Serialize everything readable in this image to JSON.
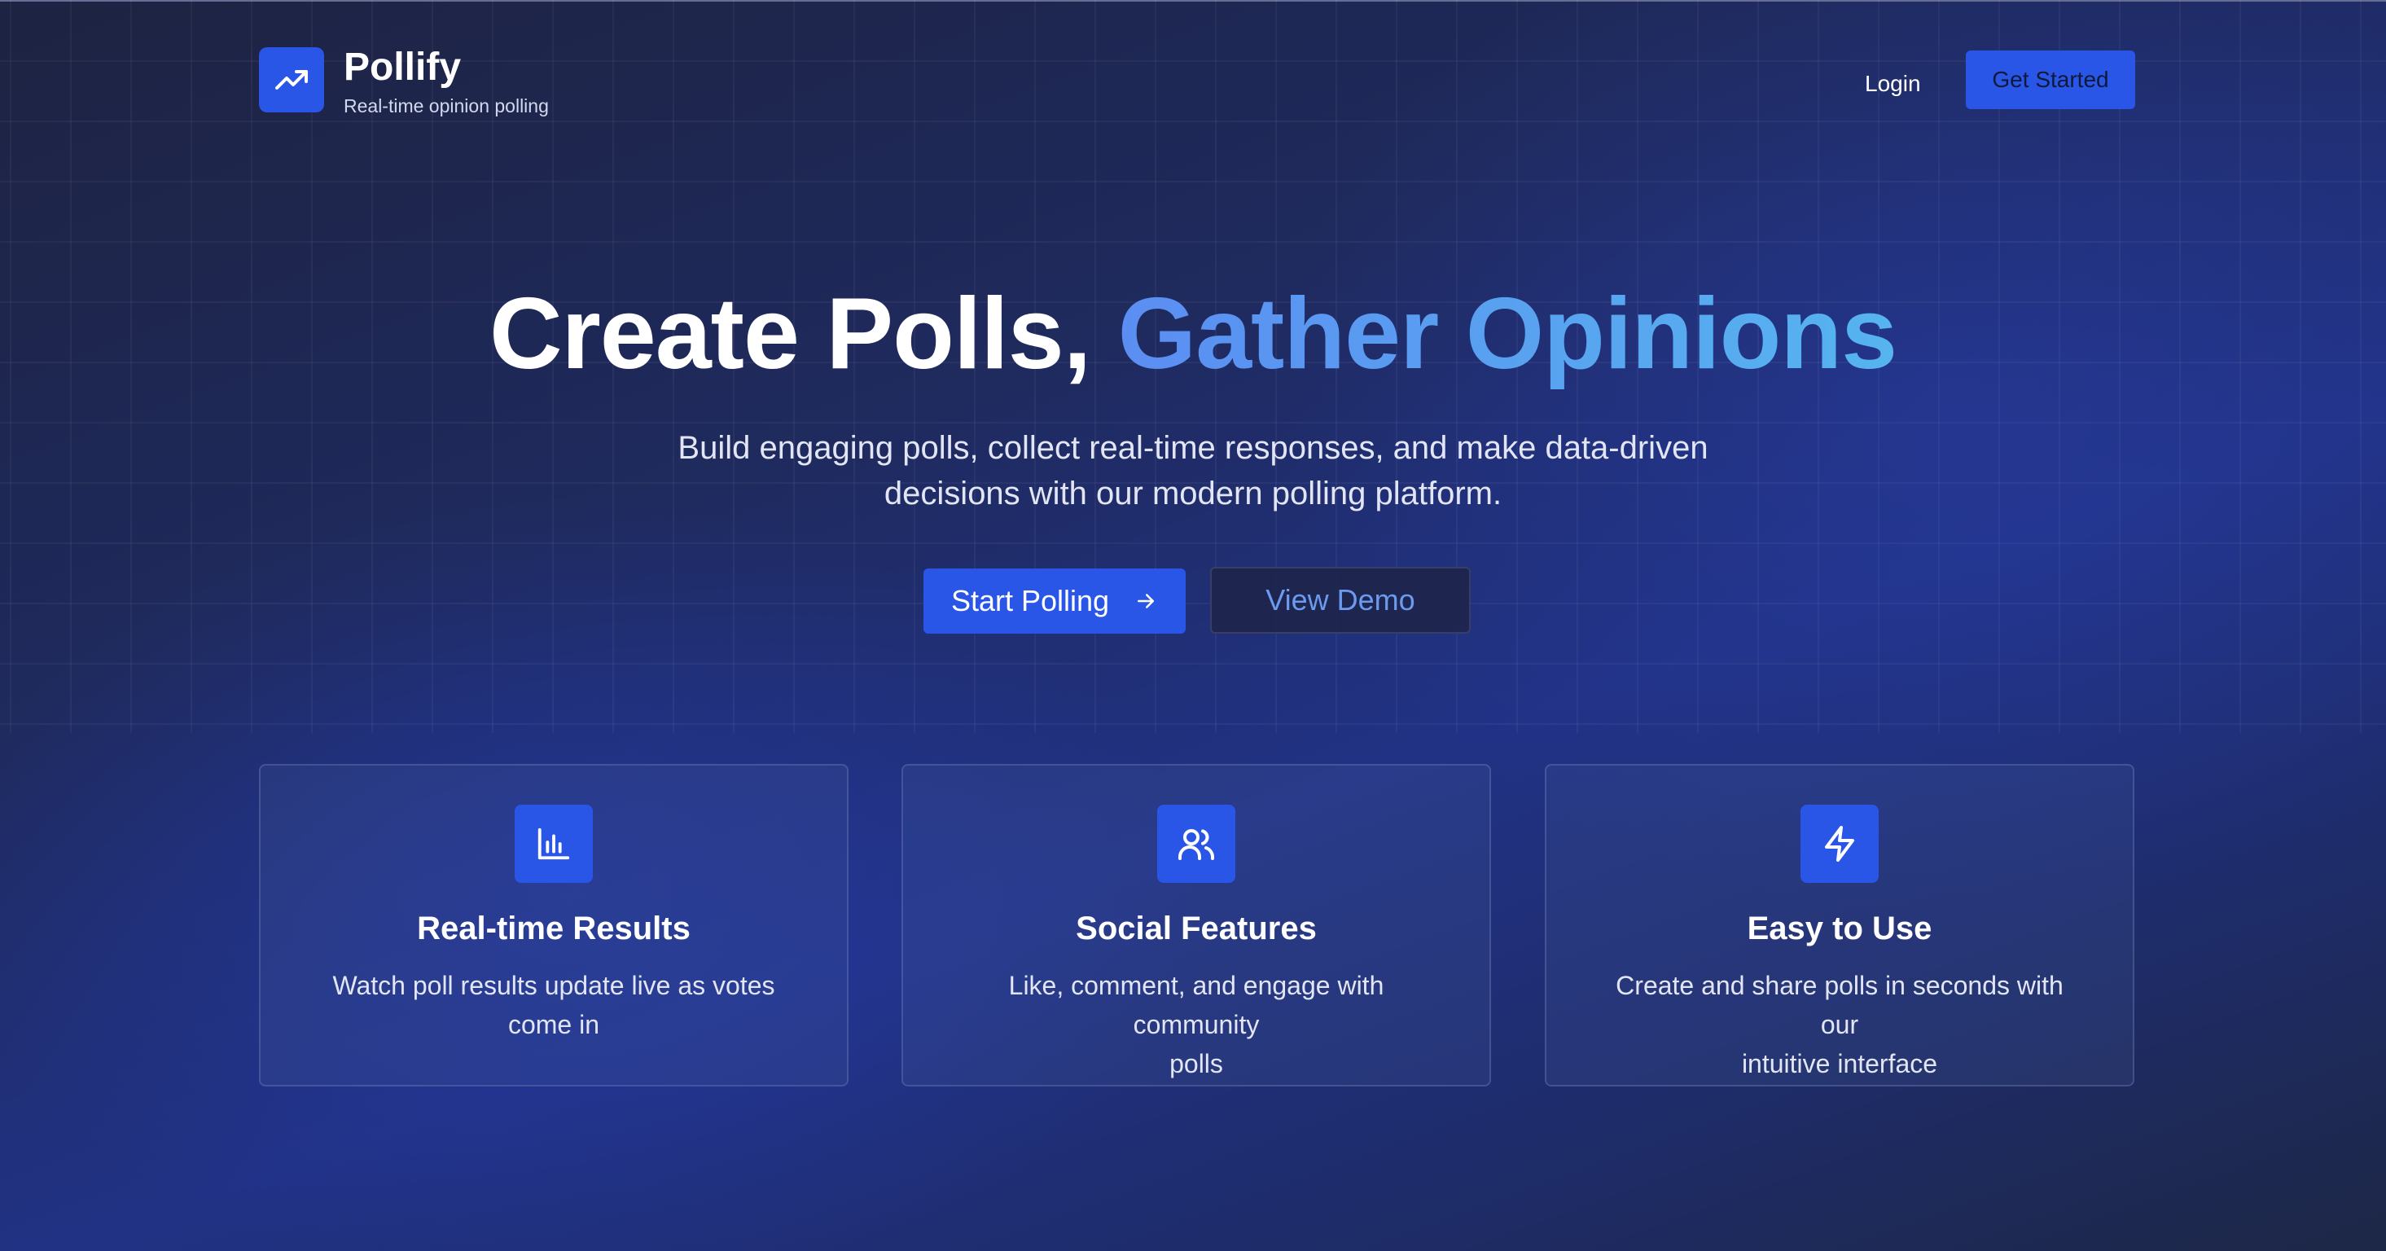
{
  "brand": {
    "name": "Pollify",
    "tagline": "Real-time opinion polling"
  },
  "nav": {
    "login_label": "Login",
    "get_started_label": "Get Started"
  },
  "hero": {
    "title_plain": "Create Polls,",
    "title_highlight": "Gather Opinions",
    "subtitle_line1": "Build engaging polls, collect real-time responses, and make data-driven",
    "subtitle_line2": "decisions with our modern polling platform.",
    "start_button_label": "Start Polling",
    "demo_button_label": "View Demo"
  },
  "features": [
    {
      "icon": "bar-chart-icon",
      "title": "Real-time Results",
      "desc_line1": "Watch poll results update live as votes",
      "desc_line2": "come in"
    },
    {
      "icon": "users-icon",
      "title": "Social Features",
      "desc_line1": "Like, comment, and engage with community",
      "desc_line2": "polls"
    },
    {
      "icon": "lightning-icon",
      "title": "Easy to Use",
      "desc_line1": "Create and share polls in seconds with our",
      "desc_line2": "intuitive interface"
    }
  ],
  "colors": {
    "accent": "#2a56e8",
    "highlight_start": "#5b8ef2",
    "highlight_end": "#56b4ef",
    "background_dark": "#1d2341",
    "background_blue": "#213285"
  }
}
